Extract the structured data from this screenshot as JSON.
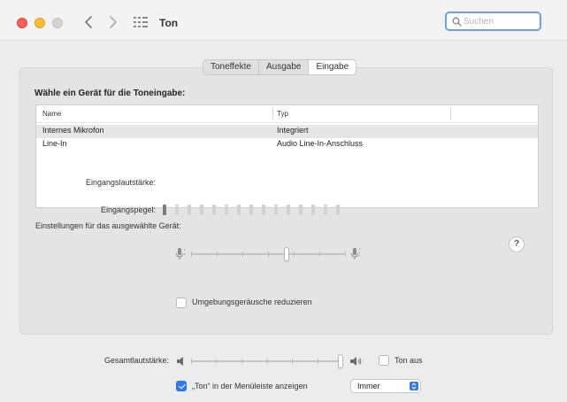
{
  "window": {
    "title": "Ton"
  },
  "search": {
    "placeholder": "Suchen"
  },
  "tabs": [
    {
      "label": "Toneffekte",
      "active": false
    },
    {
      "label": "Ausgabe",
      "active": false
    },
    {
      "label": "Eingabe",
      "active": true
    }
  ],
  "input": {
    "section_title": "Wähle ein Gerät für die Toneingabe:",
    "columns": {
      "name": "Name",
      "type": "Typ"
    },
    "devices": [
      {
        "name": "Internes Mikrofon",
        "type": "Integriert",
        "selected": true
      },
      {
        "name": "Line-In",
        "type": "Audio Line-In-Anschluss",
        "selected": false
      }
    ],
    "settings_label": "Einstellungen für das ausgewählte Gerät:",
    "volume_label": "Eingangslautstärke:",
    "volume_level": 0.62,
    "level_label": "Eingangspegel:",
    "level_segments_total": 15,
    "level_segments_active": 1,
    "noise_reduction_label": "Umgebungsgeräusche reduzieren",
    "noise_reduction_checked": false
  },
  "help": {
    "label": "?"
  },
  "output": {
    "total_volume_label": "Gesamtlautstärke:",
    "total_volume_level": 1.0,
    "mute_label": "Ton aus",
    "mute_checked": false,
    "menubar_label": "„Ton“ in der Menüleiste anzeigen",
    "menubar_checked": true,
    "menubar_select_value": "Immer"
  },
  "colors": {
    "accent": "#2f7bf5",
    "close": "#fd5f57",
    "minimize": "#febc2e",
    "zoom_inactive": "#d3d3d3"
  },
  "icons": [
    "back-chevron-icon",
    "forward-chevron-icon",
    "grid-icon",
    "search-icon",
    "microphone-icon",
    "speaker-icon",
    "speaker-loud-icon",
    "help-icon"
  ]
}
